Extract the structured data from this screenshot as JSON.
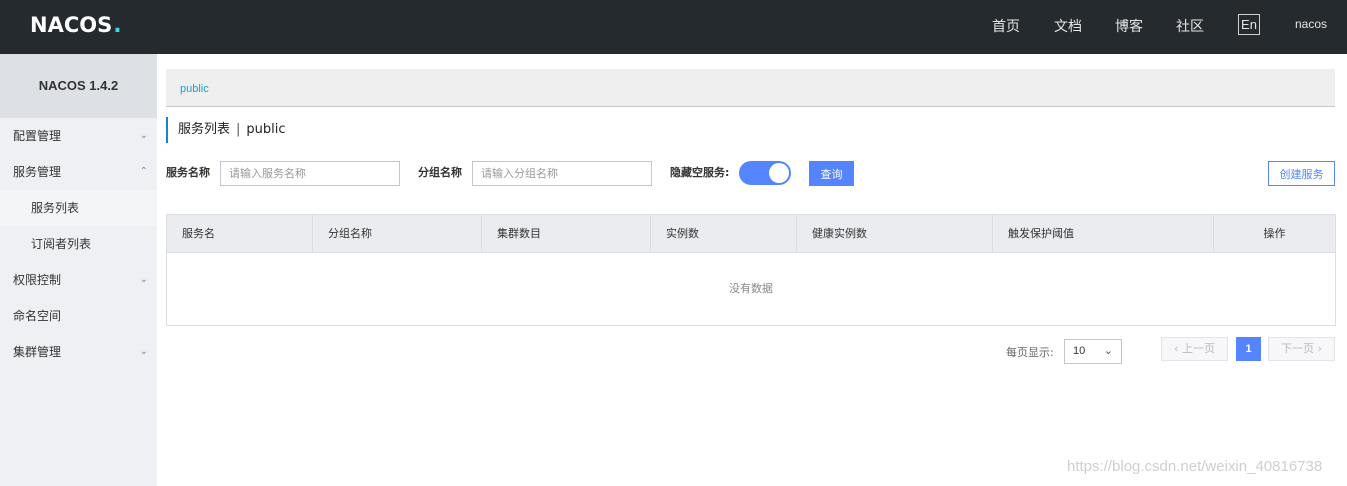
{
  "header": {
    "logo_text": "NACOS",
    "nav": [
      "首页",
      "文档",
      "博客",
      "社区"
    ],
    "lang": "En",
    "user": "nacos"
  },
  "sidebar": {
    "title": "NACOS 1.4.2",
    "items": [
      {
        "label": "配置管理",
        "expanded": false
      },
      {
        "label": "服务管理",
        "expanded": true
      },
      {
        "label": "服务列表",
        "sub": true,
        "active": true
      },
      {
        "label": "订阅者列表",
        "sub": true
      },
      {
        "label": "权限控制",
        "expanded": false
      },
      {
        "label": "命名空间"
      },
      {
        "label": "集群管理",
        "expanded": false
      }
    ]
  },
  "breadcrumb": "public",
  "page": {
    "title": "服务列表",
    "namespace": "public"
  },
  "filters": {
    "service_name_label": "服务名称",
    "service_name_placeholder": "请输入服务名称",
    "group_name_label": "分组名称",
    "group_name_placeholder": "请输入分组名称",
    "hide_empty_label": "隐藏空服务:",
    "hide_empty_on": true,
    "query_label": "查询",
    "create_label": "创建服务"
  },
  "table": {
    "columns": [
      "服务名",
      "分组名称",
      "集群数目",
      "实例数",
      "健康实例数",
      "触发保护阈值",
      "操作"
    ],
    "empty_text": "没有数据"
  },
  "pagination": {
    "page_size_label": "每页显示:",
    "page_size": "10",
    "prev_label": "上一页",
    "next_label": "下一页",
    "current_page": "1"
  },
  "watermark": "https://blog.csdn.net/weixin_40816738",
  "colors": {
    "topbar": "#252a2f",
    "primary": "#5584ff",
    "link": "#1b9cd6",
    "logo_accent": "#40d4e4"
  }
}
